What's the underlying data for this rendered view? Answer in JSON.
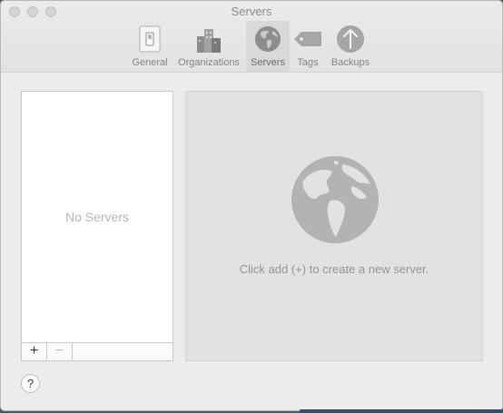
{
  "window": {
    "title": "Servers"
  },
  "toolbar": {
    "items": [
      {
        "label": "General",
        "icon": "switch-icon"
      },
      {
        "label": "Organizations",
        "icon": "buildings-icon"
      },
      {
        "label": "Servers",
        "icon": "globe-icon",
        "selected": true
      },
      {
        "label": "Tags",
        "icon": "tag-icon"
      },
      {
        "label": "Backups",
        "icon": "upload-arrow-icon"
      }
    ]
  },
  "server_list": {
    "empty_text": "No Servers",
    "add_label": "+",
    "remove_label": "−"
  },
  "detail": {
    "message": "Click add (+) to create a new server.",
    "icon": "globe-icon"
  },
  "help": {
    "label": "?"
  }
}
